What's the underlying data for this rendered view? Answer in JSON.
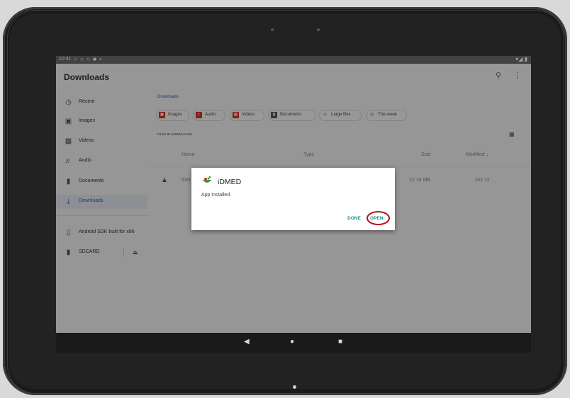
{
  "status_bar": {
    "time": "10:41",
    "notification_icons": "○ ○ ○ ■ •",
    "system_icons": "▾◢ ▮"
  },
  "app_bar": {
    "title": "Downloads",
    "search_icon": "search-icon",
    "more_icon": "more-vert-icon"
  },
  "sidebar": {
    "items": [
      {
        "label": "Recent",
        "icon": "clock-icon"
      },
      {
        "label": "Images",
        "icon": "image-icon"
      },
      {
        "label": "Videos",
        "icon": "movie-icon"
      },
      {
        "label": "Audio",
        "icon": "audio-icon"
      },
      {
        "label": "Documents",
        "icon": "document-icon"
      },
      {
        "label": "Downloads",
        "icon": "download-icon",
        "active": true
      }
    ],
    "devices": [
      {
        "label": "Android SDK built for x86",
        "icon": "phone-icon"
      },
      {
        "label": "SDCARD",
        "icon": "sdcard-icon",
        "eject_icon": "eject-icon"
      }
    ]
  },
  "content": {
    "breadcrumb": "Downloads",
    "chips": [
      {
        "label": "Images",
        "color": "#d93025"
      },
      {
        "label": "Audio",
        "color": "#d93025"
      },
      {
        "label": "Videos",
        "color": "#d93025"
      },
      {
        "label": "Documents",
        "color": "#444444"
      },
      {
        "label": "Large files",
        "color": "#444444"
      },
      {
        "label": "This week",
        "color": "#444444"
      }
    ],
    "section_label": "FILES IN DOWNLOADS",
    "columns": {
      "name": "Name",
      "type": "Type",
      "size": "Size",
      "modified": "Modified ↓"
    },
    "rows": [
      {
        "name": "iDM",
        "size": "12.16 MB",
        "modified": "Oct 12"
      }
    ]
  },
  "dialog": {
    "app_name": "iDMED",
    "message": "App installed.",
    "done_label": "DONE",
    "open_label": "OPEN",
    "highlight_color": "#b5121b",
    "button_color": "#1a8f88"
  },
  "nav_bar": {
    "back_icon": "back-icon",
    "home_icon": "home-icon",
    "recents_icon": "recents-icon"
  }
}
